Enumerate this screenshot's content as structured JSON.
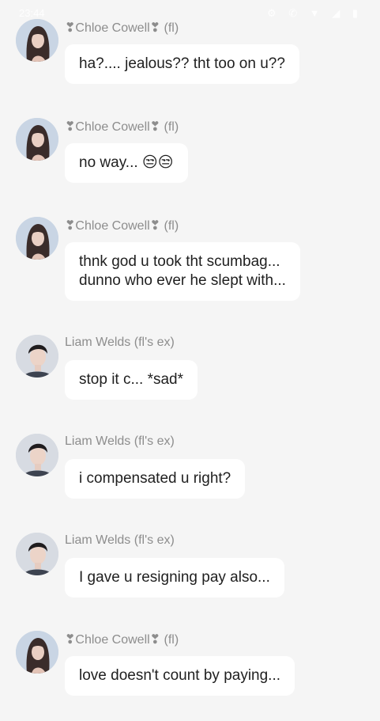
{
  "status_bar": {
    "time": "23:44",
    "icons": "⚙ ✆ ▼ ◢ ▮"
  },
  "messages": [
    {
      "sender": "❣Chloe Cowell❣ (fl)",
      "text": "ha?.... jealous?? tht too on u??"
    },
    {
      "sender": "❣Chloe Cowell❣ (fl)",
      "text": "no way... 😒😒"
    },
    {
      "sender": "❣Chloe Cowell❣ (fl)",
      "text": "thnk god u took tht scumbag...\ndunno who ever he slept with..."
    },
    {
      "sender": "Liam Welds (fl's ex)",
      "text": "stop it c... *sad*"
    },
    {
      "sender": "Liam Welds (fl's ex)",
      "text": "i compensated u right?"
    },
    {
      "sender": "Liam Welds (fl's ex)",
      "text": "I gave u resigning pay also..."
    },
    {
      "sender": "❣Chloe Cowell❣ (fl)",
      "text": "love doesn't count by paying..."
    }
  ]
}
